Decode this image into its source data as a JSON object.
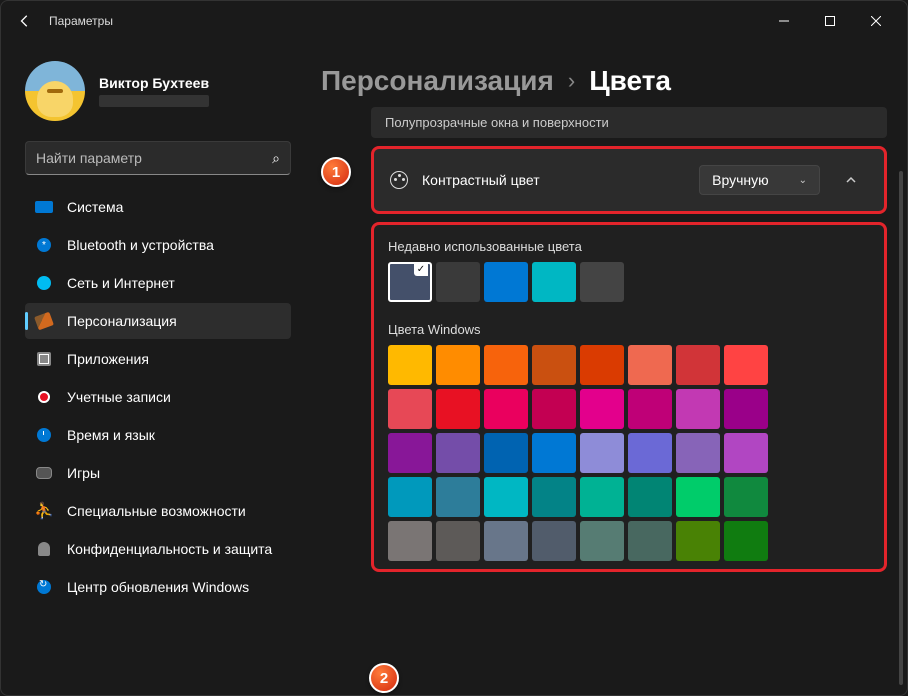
{
  "app_title": "Параметры",
  "user": {
    "name": "Виктор Бухтеев"
  },
  "search": {
    "placeholder": "Найти параметр"
  },
  "nav": {
    "system": "Система",
    "bluetooth": "Bluetooth и устройства",
    "network": "Сеть и Интернет",
    "personalization": "Персонализация",
    "apps": "Приложения",
    "accounts": "Учетные записи",
    "time": "Время и язык",
    "gaming": "Игры",
    "accessibility": "Специальные возможности",
    "privacy": "Конфиденциальность и защита",
    "update": "Центр обновления Windows"
  },
  "breadcrumb": {
    "parent": "Персонализация",
    "current": "Цвета"
  },
  "transparency_label": "Полупрозрачные окна и поверхности",
  "accent": {
    "label": "Контрастный цвет",
    "mode": "Вручную"
  },
  "recent_label": "Недавно использованные цвета",
  "recent_colors": [
    "#44506a",
    "#3a3a3a",
    "#0078d4",
    "#00b7c3",
    "#444444"
  ],
  "windows_colors_label": "Цвета Windows",
  "windows_colors": [
    "#ffb900",
    "#ff8c00",
    "#f7630c",
    "#ca5010",
    "#da3b01",
    "#ef6950",
    "#d13438",
    "#ff4343",
    "#e74856",
    "#e81123",
    "#ea005e",
    "#c30052",
    "#e3008c",
    "#bf0077",
    "#c239b3",
    "#9a0089",
    "#881798",
    "#744da9",
    "#0063b1",
    "#0078d4",
    "#8e8cd8",
    "#6b69d6",
    "#8764b8",
    "#b146c2",
    "#0099bc",
    "#2d7d9a",
    "#00b7c3",
    "#038387",
    "#00b294",
    "#018574",
    "#00cc6a",
    "#10893e",
    "#7a7574",
    "#5d5a58",
    "#68768a",
    "#515c6b",
    "#567c73",
    "#486860",
    "#498205",
    "#107c10"
  ],
  "badges": {
    "b1": "1",
    "b2": "2"
  }
}
